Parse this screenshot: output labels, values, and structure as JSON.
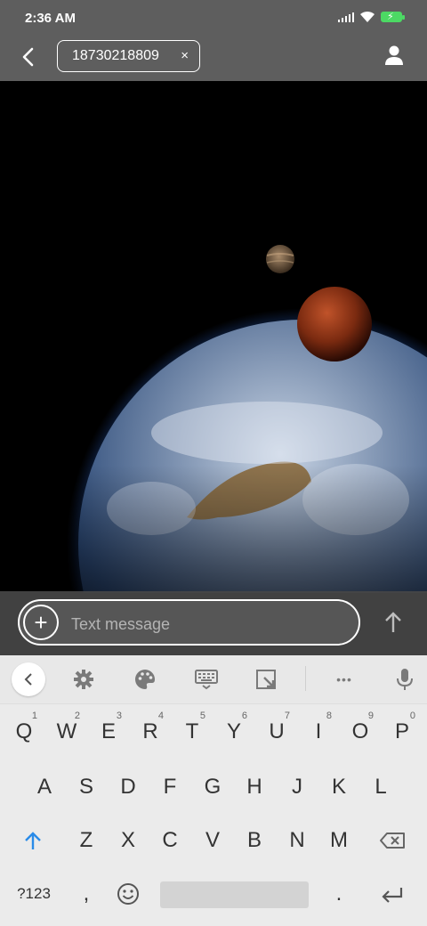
{
  "status_bar": {
    "time": "2:36 AM",
    "icons": [
      "signal-icon",
      "wifi-icon",
      "battery-charging-icon"
    ]
  },
  "header": {
    "back_icon": "chevron-left-icon",
    "recipient": "18730218809",
    "remove_icon": "×",
    "contact_icon": "person-icon"
  },
  "compose": {
    "placeholder": "Text message",
    "attach_icon": "+",
    "send_icon": "arrow-up-icon"
  },
  "keyboard": {
    "toolbar": [
      "collapse-icon",
      "gear-icon",
      "palette-icon",
      "keyboard-icon",
      "resize-icon",
      "more-icon",
      "mic-icon"
    ],
    "more_label": "•••",
    "row1": [
      {
        "key": "Q",
        "hint": "1"
      },
      {
        "key": "W",
        "hint": "2"
      },
      {
        "key": "E",
        "hint": "3"
      },
      {
        "key": "R",
        "hint": "4"
      },
      {
        "key": "T",
        "hint": "5"
      },
      {
        "key": "Y",
        "hint": "6"
      },
      {
        "key": "U",
        "hint": "7"
      },
      {
        "key": "I",
        "hint": "8"
      },
      {
        "key": "O",
        "hint": "9"
      },
      {
        "key": "P",
        "hint": "0"
      }
    ],
    "row2": [
      "A",
      "S",
      "D",
      "F",
      "G",
      "H",
      "J",
      "K",
      "L"
    ],
    "row3": [
      "Z",
      "X",
      "C",
      "V",
      "B",
      "N",
      "M"
    ],
    "symbols_label": "?123",
    "comma": ",",
    "period": ".",
    "emoji_icon": "smiley-icon",
    "shift_icon": "shift-arrow-icon",
    "delete_icon": "backspace-icon",
    "enter_icon": "enter-icon"
  },
  "colors": {
    "header_bg": "#5e5e5e",
    "keyboard_bg": "#ebebeb",
    "shift_active": "#2a8be8",
    "battery": "#4cd964"
  }
}
